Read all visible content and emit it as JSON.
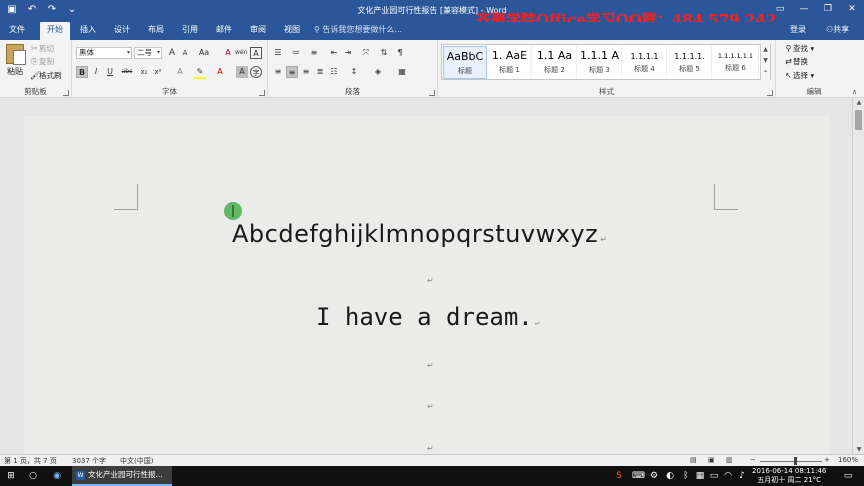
{
  "window": {
    "title": "文化产业园可行性报告 [兼容模式] - Word",
    "watermark": "齐聚学院Office学习QQ群：484 579 242",
    "qat": {
      "save_icon": "save-icon",
      "undo_icon": "undo-icon",
      "redo_icon": "redo-icon",
      "customize_icon": "customize-icon"
    },
    "controls": {
      "ribbon_options": "ribbon-options-icon",
      "minimize": "minimize-icon",
      "restore": "restore-icon",
      "close": "close-icon"
    }
  },
  "menu": {
    "tabs": [
      "文件",
      "开始",
      "插入",
      "设计",
      "布局",
      "引用",
      "邮件",
      "审阅",
      "视图"
    ],
    "active_tab": "开始",
    "tell_me": "告诉我您想要做什么...",
    "signin": "登录",
    "share": "共享"
  },
  "ribbon": {
    "clipboard": {
      "label": "剪贴板",
      "paste": "粘贴",
      "cut": "剪切",
      "copy": "复制",
      "format_painter": "格式刷"
    },
    "font": {
      "label": "字体",
      "font_name": "黑体",
      "font_size": "二号",
      "bold": "B",
      "italic": "I",
      "underline": "U",
      "strikethrough": "abc",
      "subscript": "x₂",
      "superscript": "x²",
      "grow": "A",
      "shrink": "A",
      "change_case": "Aa",
      "clear_format": "A",
      "phonetic": "wén",
      "char_border": "A",
      "font_color": "A",
      "highlight_color": "#ffff00",
      "font_color_value": "#ff0000"
    },
    "paragraph": {
      "label": "段落"
    },
    "styles": {
      "label": "样式",
      "items": [
        {
          "sample": "AaBbC",
          "name": "标题"
        },
        {
          "sample": "1. AaE",
          "name": "标题 1"
        },
        {
          "sample": "1.1 Aa",
          "name": "标题 2"
        },
        {
          "sample": "1.1.1 A",
          "name": "标题 3"
        },
        {
          "sample": "1.1.1.1",
          "name": "标题 4"
        },
        {
          "sample": "1.1.1.1.",
          "name": "标题 5"
        },
        {
          "sample": "1.1.1.1.1.1",
          "name": "标题 6"
        }
      ]
    },
    "editing": {
      "label": "编辑",
      "find": "查找",
      "replace": "替换",
      "select": "选择"
    }
  },
  "document": {
    "line1": "Abcdefghijklmnopqrstuvwxyz",
    "line2": "I have a dream.",
    "paragraph_mark": "↵"
  },
  "status": {
    "page": "第 1 页，共 7 页",
    "words": "3037 个字",
    "language": "中文(中国)",
    "zoom": "160%",
    "zoom_out": "−",
    "zoom_in": "+"
  },
  "taskbar": {
    "task_label": "文化产业园可行性报...",
    "date": "2016-06-14",
    "time": "08:11:46",
    "lunar": "五月初十 周二 21°C"
  }
}
